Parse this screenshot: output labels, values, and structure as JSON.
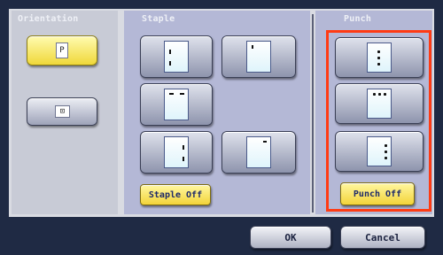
{
  "orientation": {
    "title": "Orientation",
    "portrait_glyph": "P",
    "landscape_glyph": "⊡"
  },
  "staple": {
    "title": "Staple",
    "off_label": "Staple Off"
  },
  "punch": {
    "title": "Punch",
    "off_label": "Punch Off"
  },
  "footer": {
    "ok_label": "OK",
    "cancel_label": "Cancel"
  },
  "colors": {
    "highlight": "#ff3b14",
    "selected_button": "#f0d83a",
    "panel": "#b4b8d6"
  }
}
